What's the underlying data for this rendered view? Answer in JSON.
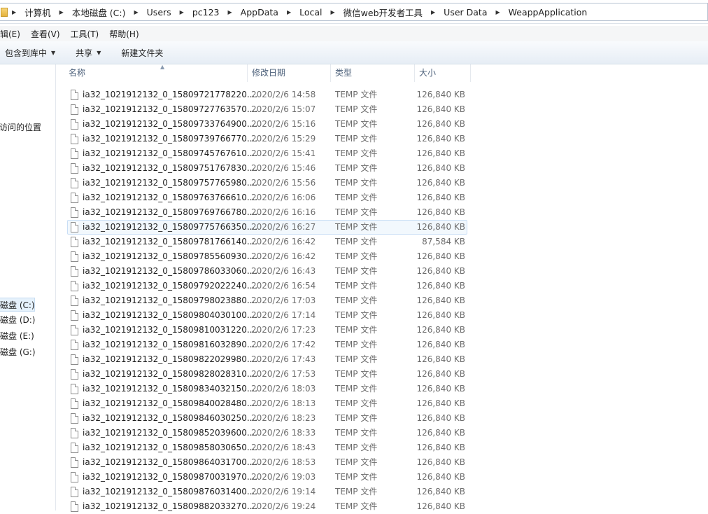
{
  "address_bar": {
    "crumbs": [
      "计算机",
      "本地磁盘 (C:)",
      "Users",
      "pc123",
      "AppData",
      "Local",
      "微信web开发者工具",
      "User Data",
      "WeappApplication"
    ]
  },
  "menu": {
    "items": [
      "编辑(E)",
      "查看(V)",
      "工具(T)",
      "帮助(H)"
    ]
  },
  "toolbar": {
    "include_label": "包含到库中",
    "share_label": "共享",
    "new_folder_label": "新建文件夹"
  },
  "nav": {
    "recent_places": "访问的位置",
    "drives": [
      "磁盘 (C:)",
      "磁盘 (D:)",
      "磁盘 (E:)",
      "磁盘 (G:)"
    ]
  },
  "columns": {
    "name": "名称",
    "date": "修改日期",
    "type": "类型",
    "size": "大小"
  },
  "files": [
    {
      "name": "ia32_1021912132_0_15809721778220....",
      "date": "2020/2/6 14:58",
      "type": "TEMP 文件",
      "size": "126,840 KB"
    },
    {
      "name": "ia32_1021912132_0_15809727763570....",
      "date": "2020/2/6 15:07",
      "type": "TEMP 文件",
      "size": "126,840 KB"
    },
    {
      "name": "ia32_1021912132_0_15809733764900....",
      "date": "2020/2/6 15:16",
      "type": "TEMP 文件",
      "size": "126,840 KB"
    },
    {
      "name": "ia32_1021912132_0_15809739766770....",
      "date": "2020/2/6 15:29",
      "type": "TEMP 文件",
      "size": "126,840 KB"
    },
    {
      "name": "ia32_1021912132_0_15809745767610....",
      "date": "2020/2/6 15:41",
      "type": "TEMP 文件",
      "size": "126,840 KB"
    },
    {
      "name": "ia32_1021912132_0_15809751767830....",
      "date": "2020/2/6 15:46",
      "type": "TEMP 文件",
      "size": "126,840 KB"
    },
    {
      "name": "ia32_1021912132_0_15809757765980....",
      "date": "2020/2/6 15:56",
      "type": "TEMP 文件",
      "size": "126,840 KB"
    },
    {
      "name": "ia32_1021912132_0_15809763766610....",
      "date": "2020/2/6 16:06",
      "type": "TEMP 文件",
      "size": "126,840 KB"
    },
    {
      "name": "ia32_1021912132_0_15809769766780....",
      "date": "2020/2/6 16:16",
      "type": "TEMP 文件",
      "size": "126,840 KB"
    },
    {
      "name": "ia32_1021912132_0_15809775766350....",
      "date": "2020/2/6 16:27",
      "type": "TEMP 文件",
      "size": "126,840 KB",
      "highlighted": true
    },
    {
      "name": "ia32_1021912132_0_15809781766140....",
      "date": "2020/2/6 16:42",
      "type": "TEMP 文件",
      "size": "87,584 KB"
    },
    {
      "name": "ia32_1021912132_0_15809785560930....",
      "date": "2020/2/6 16:42",
      "type": "TEMP 文件",
      "size": "126,840 KB"
    },
    {
      "name": "ia32_1021912132_0_15809786033060....",
      "date": "2020/2/6 16:43",
      "type": "TEMP 文件",
      "size": "126,840 KB"
    },
    {
      "name": "ia32_1021912132_0_15809792022240....",
      "date": "2020/2/6 16:54",
      "type": "TEMP 文件",
      "size": "126,840 KB"
    },
    {
      "name": "ia32_1021912132_0_15809798023880....",
      "date": "2020/2/6 17:03",
      "type": "TEMP 文件",
      "size": "126,840 KB"
    },
    {
      "name": "ia32_1021912132_0_15809804030100....",
      "date": "2020/2/6 17:14",
      "type": "TEMP 文件",
      "size": "126,840 KB"
    },
    {
      "name": "ia32_1021912132_0_15809810031220....",
      "date": "2020/2/6 17:23",
      "type": "TEMP 文件",
      "size": "126,840 KB"
    },
    {
      "name": "ia32_1021912132_0_15809816032890....",
      "date": "2020/2/6 17:42",
      "type": "TEMP 文件",
      "size": "126,840 KB"
    },
    {
      "name": "ia32_1021912132_0_15809822029980....",
      "date": "2020/2/6 17:43",
      "type": "TEMP 文件",
      "size": "126,840 KB"
    },
    {
      "name": "ia32_1021912132_0_15809828028310....",
      "date": "2020/2/6 17:53",
      "type": "TEMP 文件",
      "size": "126,840 KB"
    },
    {
      "name": "ia32_1021912132_0_15809834032150....",
      "date": "2020/2/6 18:03",
      "type": "TEMP 文件",
      "size": "126,840 KB"
    },
    {
      "name": "ia32_1021912132_0_15809840028480....",
      "date": "2020/2/6 18:13",
      "type": "TEMP 文件",
      "size": "126,840 KB"
    },
    {
      "name": "ia32_1021912132_0_15809846030250....",
      "date": "2020/2/6 18:23",
      "type": "TEMP 文件",
      "size": "126,840 KB"
    },
    {
      "name": "ia32_1021912132_0_15809852039600....",
      "date": "2020/2/6 18:33",
      "type": "TEMP 文件",
      "size": "126,840 KB"
    },
    {
      "name": "ia32_1021912132_0_15809858030650....",
      "date": "2020/2/6 18:43",
      "type": "TEMP 文件",
      "size": "126,840 KB"
    },
    {
      "name": "ia32_1021912132_0_15809864031700....",
      "date": "2020/2/6 18:53",
      "type": "TEMP 文件",
      "size": "126,840 KB"
    },
    {
      "name": "ia32_1021912132_0_15809870031970....",
      "date": "2020/2/6 19:03",
      "type": "TEMP 文件",
      "size": "126,840 KB"
    },
    {
      "name": "ia32_1021912132_0_15809876031400....",
      "date": "2020/2/6 19:14",
      "type": "TEMP 文件",
      "size": "126,840 KB"
    },
    {
      "name": "ia32_1021912132_0_15809882033270....",
      "date": "2020/2/6 19:24",
      "type": "TEMP 文件",
      "size": "126,840 KB"
    }
  ]
}
